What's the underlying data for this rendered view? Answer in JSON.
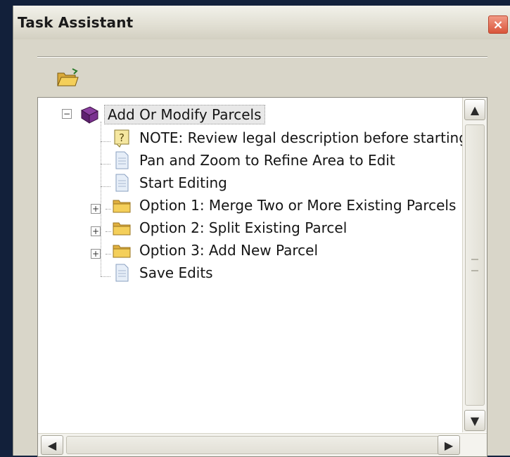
{
  "window": {
    "title": "Task Assistant",
    "close_glyph": "×"
  },
  "toolbar": {
    "open_icon": "folder-open-icon"
  },
  "tree": {
    "root": {
      "label": "Add Or Modify Parcels",
      "icon": "book-icon",
      "expanded": true
    },
    "items": [
      {
        "label": "NOTE: Review legal description before starting",
        "icon": "note-icon"
      },
      {
        "label": "Pan and Zoom to Refine Area to Edit",
        "icon": "page-icon"
      },
      {
        "label": "Start Editing",
        "icon": "page-icon"
      },
      {
        "label": "Option 1: Merge Two or More Existing Parcels",
        "icon": "folder-icon",
        "expandable": true
      },
      {
        "label": "Option 2: Split Existing Parcel",
        "icon": "folder-icon",
        "expandable": true
      },
      {
        "label": "Option 3: Add New Parcel",
        "icon": "folder-icon",
        "expandable": true
      },
      {
        "label": "Save Edits",
        "icon": "page-icon"
      }
    ]
  },
  "scrollbars": {
    "up": "▲",
    "down": "▼",
    "left": "◀",
    "right": "▶"
  },
  "colors": {
    "window_bg": "#d9d6c9",
    "panel_bg": "#ffffff",
    "close_red": "#d9553a",
    "folder_yellow": "#f0c14a",
    "book_purple": "#6a2a7a"
  }
}
